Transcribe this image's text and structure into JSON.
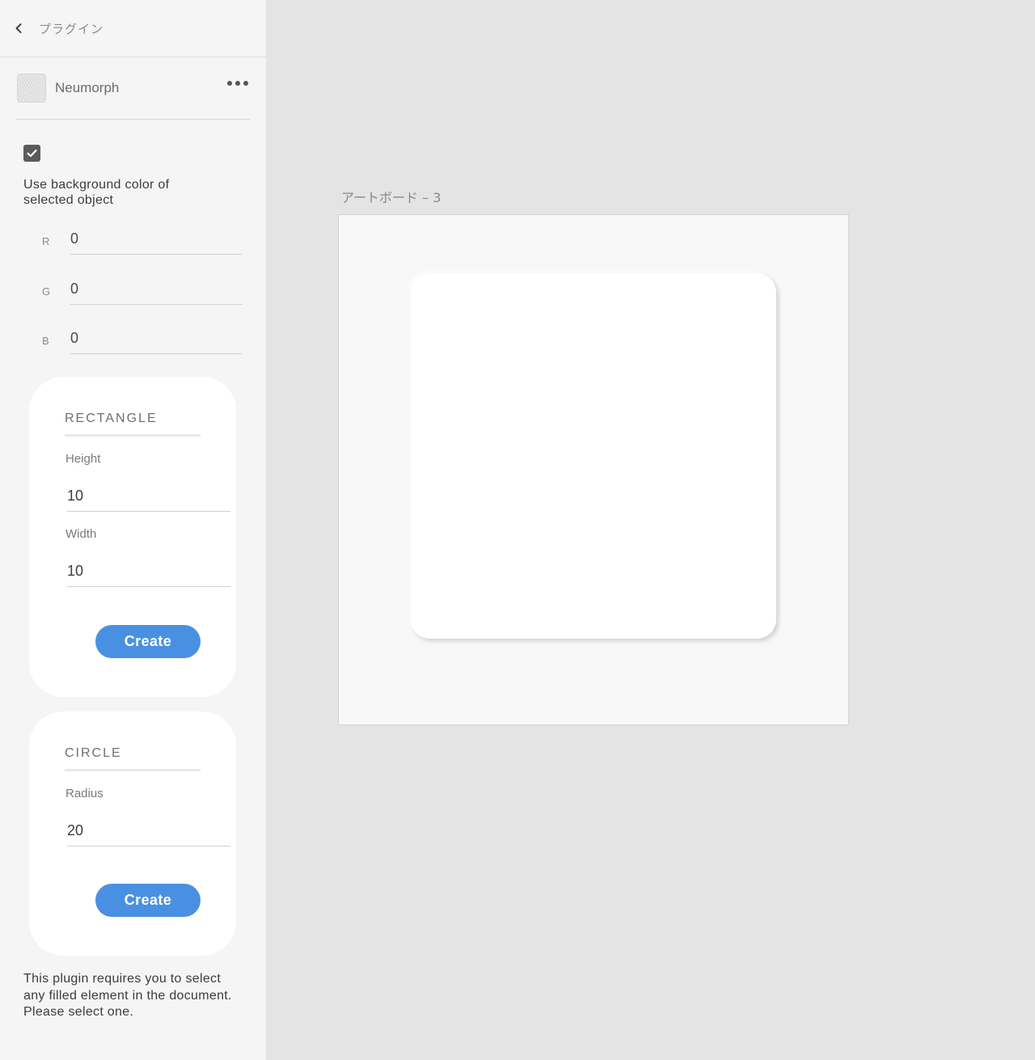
{
  "topbar": {
    "title": "プラグイン"
  },
  "plugin": {
    "name": "Neumorph"
  },
  "options": {
    "use_bg_checked": true,
    "use_bg_label": "Use background color of selected object"
  },
  "rgb": [
    {
      "label": "R",
      "value": "0"
    },
    {
      "label": "G",
      "value": "0"
    },
    {
      "label": "B",
      "value": "0"
    }
  ],
  "rectangle": {
    "title": "RECTANGLE",
    "height_label": "Height",
    "height_value": "10",
    "width_label": "Width",
    "width_value": "10",
    "create_label": "Create"
  },
  "circle": {
    "title": "CIRCLE",
    "radius_label": "Radius",
    "radius_value": "20",
    "create_label": "Create"
  },
  "footer": {
    "message": "This plugin requires you to select any filled element in the document. Please select one."
  },
  "canvas": {
    "artboard_name": "アートボード – 3"
  },
  "colors": {
    "accent": "#4a90e2",
    "sidebar_bg": "#f5f5f5",
    "canvas_bg": "#e4e4e4",
    "artboard_bg": "#f8f8f8"
  },
  "icons": {
    "back": "chevron-left-icon",
    "more": "more-horizontal-icon",
    "check": "check-icon"
  }
}
